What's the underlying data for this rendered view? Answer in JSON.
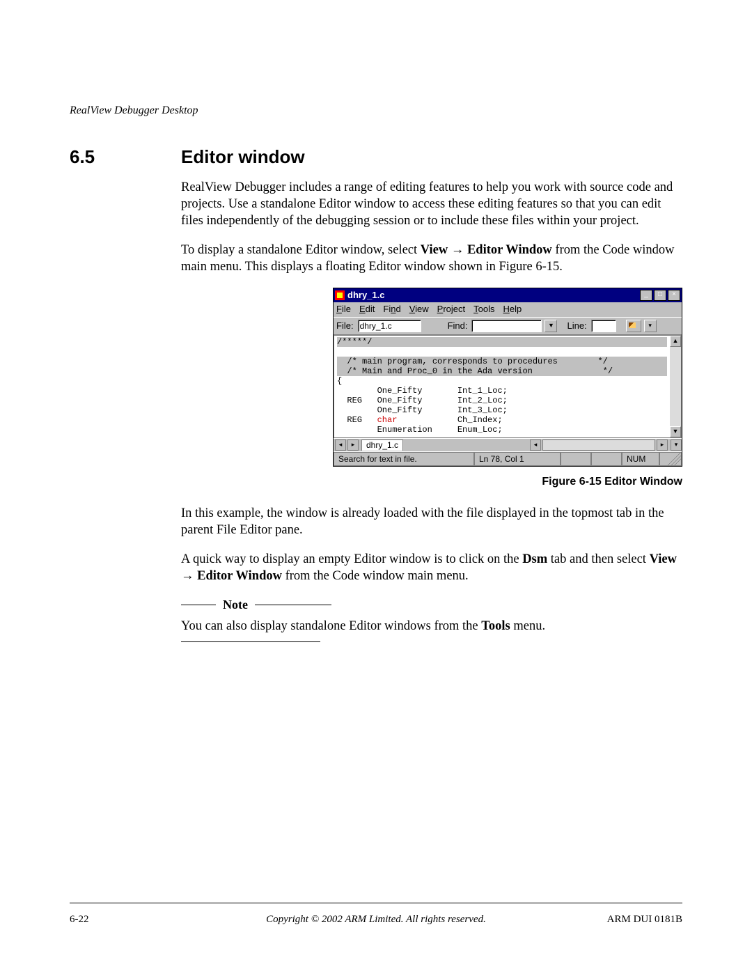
{
  "header": {
    "running": "RealView Debugger Desktop"
  },
  "section": {
    "number": "6.5",
    "title": "Editor window"
  },
  "paras": {
    "p1": "RealView Debugger includes a range of editing features to help you work with source code and projects. Use a standalone Editor window to access these editing features so that you can edit files independently of the debugging session or to include these files within your project.",
    "p2a": "To display a standalone Editor window, select ",
    "p2b": "View",
    "p2c": " → ",
    "p2d": "Editor Window",
    "p2e": " from the Code window main menu. This displays a floating Editor window shown in Figure 6-15.",
    "p3": "In this example, the window is already loaded with the file displayed in the topmost tab in the parent File Editor pane.",
    "p4a": "A quick way to display an empty Editor window is to click on the ",
    "p4b": "Dsm",
    "p4c": " tab and then select ",
    "p4d": "View",
    "p4e": " → ",
    "p4f": "Editor Window",
    "p4g": " from the Code window main menu.",
    "noteLabel": "Note",
    "noteBodyA": "You can also display standalone Editor windows from the ",
    "noteBodyB": "Tools",
    "noteBodyC": " menu."
  },
  "figure": {
    "caption": "Figure 6-15 Editor Window"
  },
  "editor": {
    "title": "dhry_1.c",
    "menus": [
      "File",
      "Edit",
      "Find",
      "View",
      "Project",
      "Tools",
      "Help"
    ],
    "toolbar": {
      "fileLabel": "File:",
      "fileValue": "dhry_1.c",
      "findLabel": "Find:",
      "findValue": "",
      "lineLabel": "Line:",
      "lineValue": ""
    },
    "code": {
      "l0": "/*****/",
      "l1": "  /* main program, corresponds to procedures        */",
      "l2": "  /* Main and Proc_0 in the Ada version              */",
      "l3": "{",
      "l4": "        One_Fifty       Int_1_Loc;",
      "l5": "  REG   One_Fifty       Int_2_Loc;",
      "l6": "        One_Fifty       Int_3_Loc;",
      "l7a": "  REG   ",
      "l7kw": "char",
      "l7b": "            Ch_Index;",
      "l8": "        Enumeration     Enum_Loc;"
    },
    "tab": "dhry_1.c",
    "status": {
      "left": "Search for text in file.",
      "pos": "Ln 78, Col 1",
      "num": "NUM"
    }
  },
  "footer": {
    "left": "6-22",
    "center": "Copyright © 2002 ARM Limited. All rights reserved.",
    "right": "ARM DUI 0181B"
  }
}
